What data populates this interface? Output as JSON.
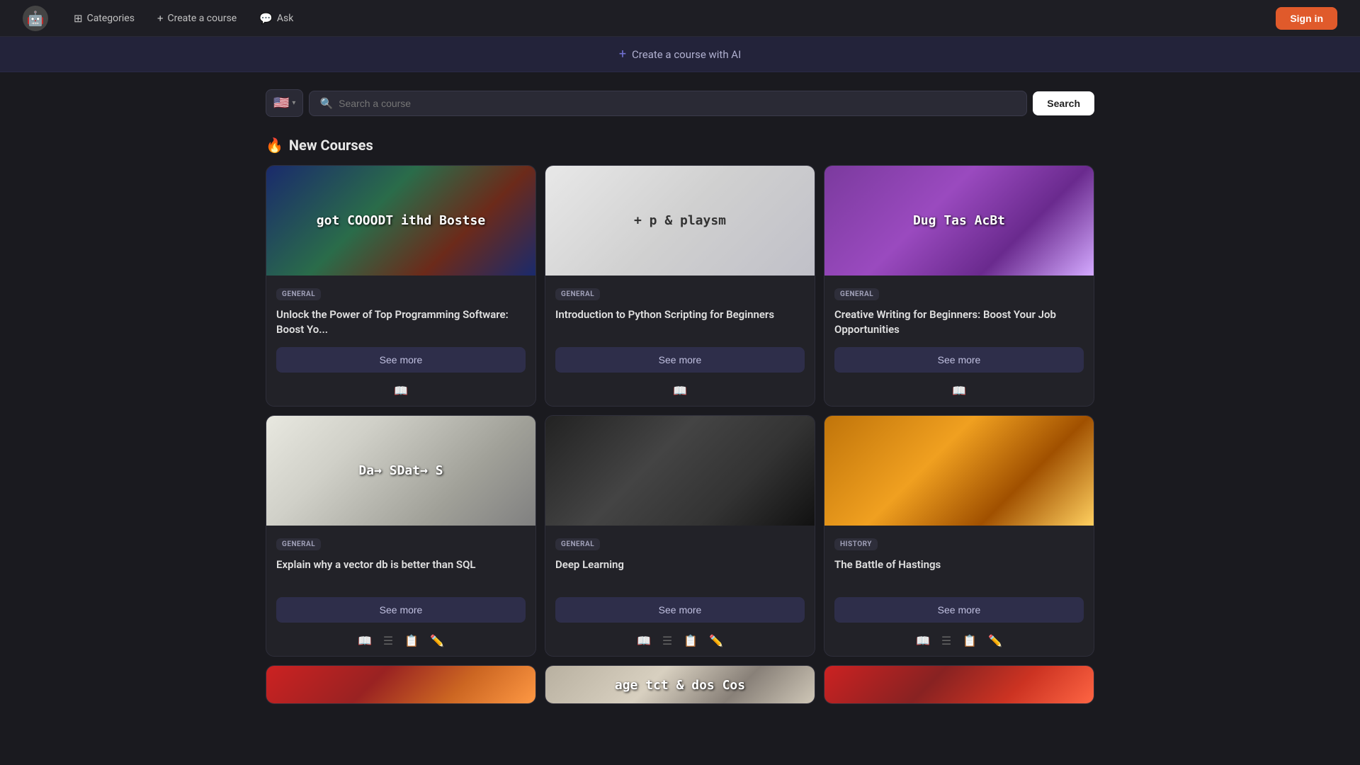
{
  "navbar": {
    "logo_emoji": "🤖",
    "categories_label": "Categories",
    "categories_icon": "⊞",
    "create_course_label": "Create a course",
    "create_course_icon": "+",
    "ask_label": "Ask",
    "ask_icon": "💬",
    "sign_in_label": "Sign in"
  },
  "ai_banner": {
    "plus_icon": "+",
    "label": "Create a course with AI"
  },
  "search": {
    "flag": "🇺🇸",
    "placeholder": "Search a course",
    "button_label": "Search"
  },
  "new_courses": {
    "title": "New Courses",
    "fire_icon": "🔥"
  },
  "courses": [
    {
      "id": "course-1",
      "badge": "GENERAL",
      "title": "Unlock the Power of Top Programming Software: Boost Yo...",
      "see_more": "See more",
      "thumb_class": "thumb-1",
      "thumb_text": "got COOODT\nithd Bostse",
      "actions": [
        "📖"
      ]
    },
    {
      "id": "course-2",
      "badge": "GENERAL",
      "title": "Introduction to Python Scripting for Beginners",
      "see_more": "See more",
      "thumb_class": "thumb-2",
      "thumb_text": "+ p & playsm",
      "actions": [
        "📖"
      ]
    },
    {
      "id": "course-3",
      "badge": "GENERAL",
      "title": "Creative Writing for Beginners: Boost Your Job Opportunities",
      "see_more": "See more",
      "thumb_class": "thumb-3",
      "thumb_text": "Dug Tas AcBt",
      "actions": [
        "📖"
      ]
    },
    {
      "id": "course-4",
      "badge": "GENERAL",
      "title": "Explain why a vector db is better than SQL",
      "see_more": "See more",
      "thumb_class": "thumb-4",
      "thumb_text": "Da→ SDat→ S",
      "actions": [
        "📖",
        "☰",
        "📋",
        "✏️"
      ]
    },
    {
      "id": "course-5",
      "badge": "GENERAL",
      "title": "Deep Learning",
      "see_more": "See more",
      "thumb_class": "thumb-5",
      "thumb_text": "",
      "actions": [
        "📖",
        "☰",
        "📋",
        "✏️"
      ]
    },
    {
      "id": "course-6",
      "badge": "HISTORY",
      "title": "The Battle of Hastings",
      "see_more": "See more",
      "thumb_class": "thumb-6",
      "thumb_text": "",
      "actions": [
        "📖",
        "☰",
        "📋",
        "✏️"
      ]
    }
  ],
  "bottom_thumbs": [
    {
      "thumb_class": "thumb-7",
      "text": ""
    },
    {
      "thumb_class": "thumb-8",
      "text": "age tct & dos Cos"
    },
    {
      "thumb_class": "thumb-9",
      "text": ""
    }
  ]
}
